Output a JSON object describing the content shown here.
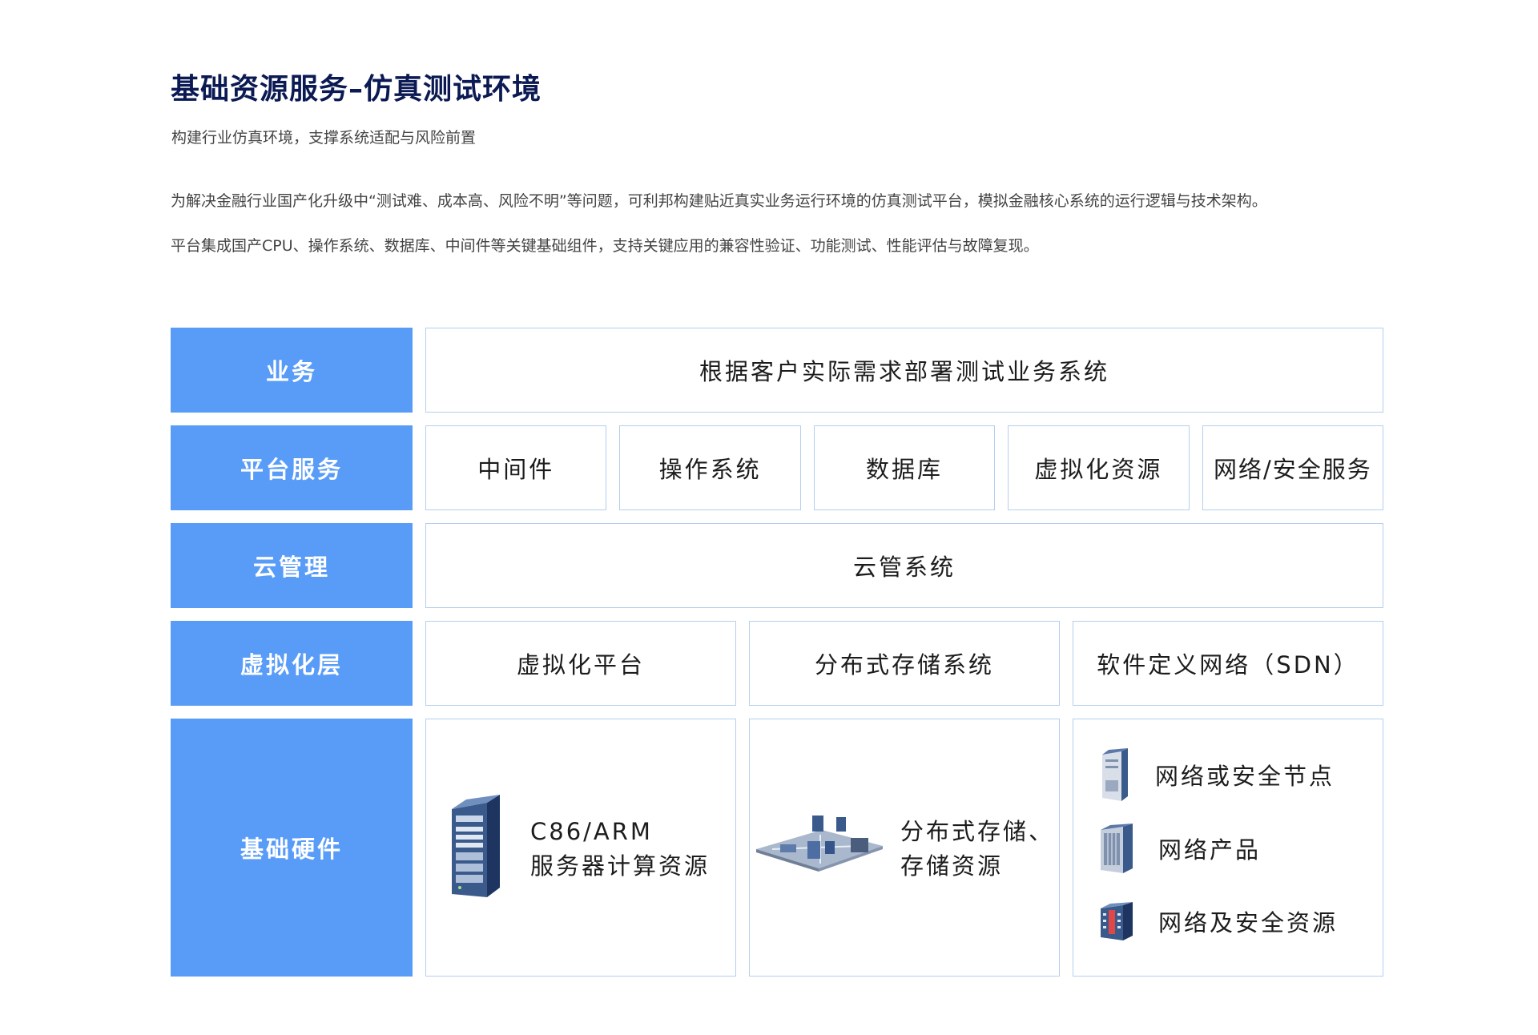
{
  "header": {
    "title": "基础资源服务–仿真测试环境",
    "subtitle": "构建行业仿真环境，支撑系统适配与风险前置",
    "paragraphs": [
      "为解决金融行业国产化升级中“测试难、成本高、风险不明”等问题，可利邦构建贴近真实业务运行环境的仿真测试平台，模拟金融核心系统的运行逻辑与技术架构。",
      "平台集成国产CPU、操作系统、数据库、中间件等关键基础组件，支持关键应用的兼容性验证、功能测试、性能评估与故障复现。"
    ]
  },
  "colors": {
    "label_bg": "#589cf8",
    "cell_border": "#b4cff0",
    "title": "#0b1a53"
  },
  "layers": [
    {
      "label": "业务",
      "cells": [
        "根据客户实际需求部署测试业务系统"
      ]
    },
    {
      "label": "平台服务",
      "cells": [
        "中间件",
        "操作系统",
        "数据库",
        "虚拟化资源",
        "网络/安全服务"
      ]
    },
    {
      "label": "云管理",
      "cells": [
        "云管系统"
      ]
    },
    {
      "label": "虚拟化层",
      "cells": [
        "虚拟化平台",
        "分布式存储系统",
        "软件定义网络（SDN）"
      ]
    }
  ],
  "hardware": {
    "label": "基础硬件",
    "server": {
      "icon": "server-tower-icon",
      "lines": [
        "C86/ARM",
        "服务器计算资源"
      ]
    },
    "storage": {
      "icon": "storage-network-icon",
      "lines": [
        "分布式存储、",
        "存储资源"
      ]
    },
    "network": [
      {
        "icon": "server-rack-icon",
        "label": "网络或安全节点"
      },
      {
        "icon": "network-cabinet-icon",
        "label": "网络产品"
      },
      {
        "icon": "firewall-device-icon",
        "label": "网络及安全资源"
      }
    ]
  }
}
